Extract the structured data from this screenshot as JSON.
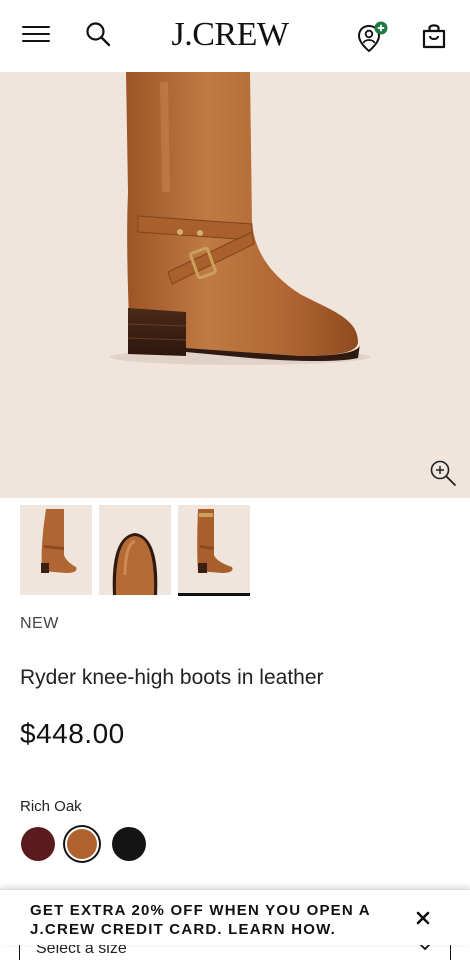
{
  "header": {
    "logo": "J.CREW",
    "icons": [
      "menu-icon",
      "search-icon",
      "store-locator-icon",
      "shopping-bag-icon"
    ]
  },
  "gallery": {
    "zoom_icon": "zoom-in-icon",
    "thumbnails": [
      "front-view",
      "toe-view",
      "side-view"
    ],
    "selected_thumbnail": 3
  },
  "product": {
    "badge": "NEW",
    "title": "Ryder knee-high boots in leather",
    "price": "$448.00",
    "color_label": "Rich Oak",
    "swatches": [
      {
        "name": "burgundy",
        "color": "#5a1b1e"
      },
      {
        "name": "rich-oak",
        "color": "#b0622e",
        "selected": true
      },
      {
        "name": "black",
        "color": "#141414"
      }
    ],
    "size_select": "Select a size"
  },
  "promo": {
    "line1": "GET EXTRA 20% OFF WHEN YOU OPEN A",
    "line2": "J.CREW CREDIT CARD. LEARN HOW.",
    "close_icon": "close-icon"
  }
}
